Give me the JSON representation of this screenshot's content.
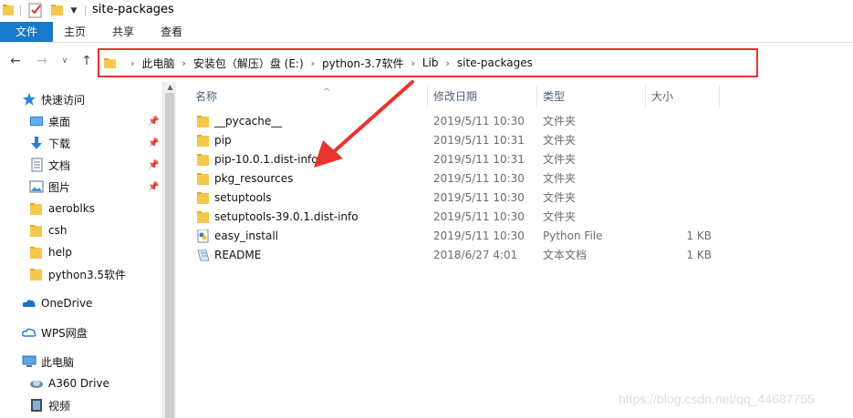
{
  "window": {
    "title": "site-packages"
  },
  "ribbon": {
    "tabs": [
      "文件",
      "主页",
      "共享",
      "查看"
    ]
  },
  "address": {
    "crumbs": [
      "此电脑",
      "安装包（解压）盘 (E:)",
      "python-3.7软件",
      "Lib",
      "site-packages"
    ],
    "highlight_color": "#e8332f"
  },
  "navpane": {
    "items": [
      {
        "label": "快速访问",
        "icon": "star-icon",
        "pinned": false
      },
      {
        "label": "桌面",
        "icon": "desktop-icon",
        "pinned": true
      },
      {
        "label": "下载",
        "icon": "download-icon",
        "pinned": true
      },
      {
        "label": "文档",
        "icon": "document-icon",
        "pinned": true
      },
      {
        "label": "图片",
        "icon": "picture-icon",
        "pinned": true
      },
      {
        "label": "aeroblks",
        "icon": "folder-icon",
        "pinned": false
      },
      {
        "label": "csh",
        "icon": "folder-icon",
        "pinned": false
      },
      {
        "label": "help",
        "icon": "folder-icon",
        "pinned": false
      },
      {
        "label": "python3.5软件",
        "icon": "folder-icon",
        "pinned": false
      },
      {
        "label": "OneDrive",
        "icon": "cloud-icon",
        "pinned": false
      },
      {
        "label": "WPS网盘",
        "icon": "wps-cloud-icon",
        "pinned": false
      },
      {
        "label": "此电脑",
        "icon": "computer-icon",
        "pinned": false
      },
      {
        "label": "A360 Drive",
        "icon": "a360-icon",
        "pinned": false
      },
      {
        "label": "视频",
        "icon": "video-icon",
        "pinned": false
      }
    ]
  },
  "columns": {
    "name": "名称",
    "modified": "修改日期",
    "type": "类型",
    "size": "大小"
  },
  "files": [
    {
      "name": "__pycache__",
      "modified": "2019/5/11 10:30",
      "type": "文件夹",
      "size": "",
      "icon": "folder-icon"
    },
    {
      "name": "pip",
      "modified": "2019/5/11 10:31",
      "type": "文件夹",
      "size": "",
      "icon": "folder-icon"
    },
    {
      "name": "pip-10.0.1.dist-info",
      "modified": "2019/5/11 10:31",
      "type": "文件夹",
      "size": "",
      "icon": "folder-icon"
    },
    {
      "name": "pkg_resources",
      "modified": "2019/5/11 10:30",
      "type": "文件夹",
      "size": "",
      "icon": "folder-icon"
    },
    {
      "name": "setuptools",
      "modified": "2019/5/11 10:30",
      "type": "文件夹",
      "size": "",
      "icon": "folder-icon"
    },
    {
      "name": "setuptools-39.0.1.dist-info",
      "modified": "2019/5/11 10:30",
      "type": "文件夹",
      "size": "",
      "icon": "folder-icon"
    },
    {
      "name": "easy_install",
      "modified": "2019/5/11 10:30",
      "type": "Python File",
      "size": "1 KB",
      "icon": "python-file-icon"
    },
    {
      "name": "README",
      "modified": "2018/6/27 4:01",
      "type": "文本文档",
      "size": "1 KB",
      "icon": "text-file-icon"
    }
  ],
  "watermark": "https://blog.csdn.net/qq_44687755",
  "colors": {
    "accent": "#1979ca",
    "folder": "#f5c84c",
    "annotation": "#e8332f"
  }
}
